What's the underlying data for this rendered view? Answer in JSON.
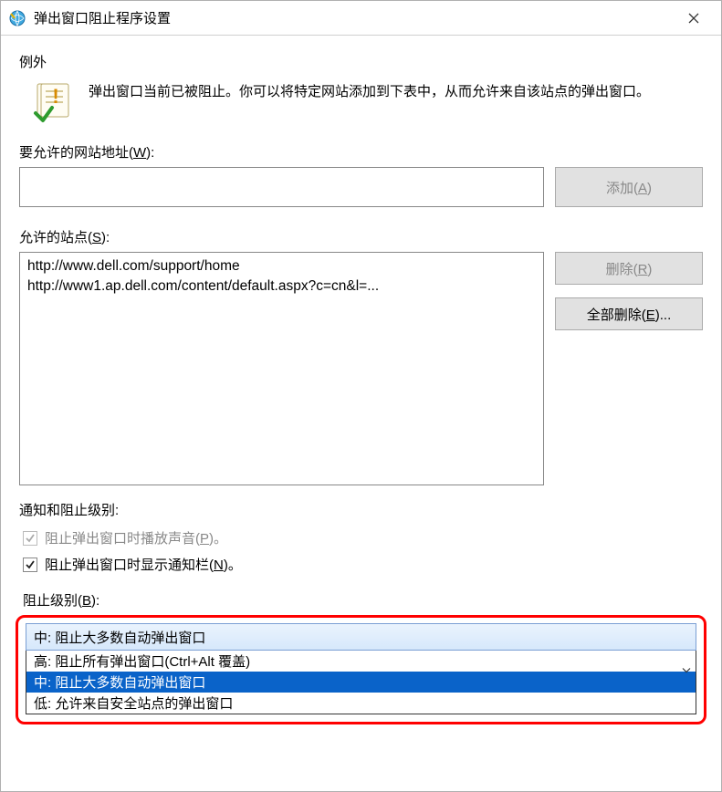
{
  "window": {
    "title": "弹出窗口阻止程序设置"
  },
  "exceptions": {
    "groupTitle": "例外",
    "infoText": "弹出窗口当前已被阻止。你可以将特定网站添加到下表中，从而允许来自该站点的弹出窗口。",
    "addressLabelPrefix": "要允许的网站地址(",
    "addressLabelKey": "W",
    "addressLabelSuffix": "):",
    "addressValue": "",
    "addButtonPrefix": "添加(",
    "addButtonKey": "A",
    "addButtonSuffix": ")",
    "allowedLabelPrefix": "允许的站点(",
    "allowedLabelKey": "S",
    "allowedLabelSuffix": "):",
    "sites": [
      "http://www.dell.com/support/home",
      "http://www1.ap.dell.com/content/default.aspx?c=cn&l=..."
    ],
    "removeButtonPrefix": "删除(",
    "removeButtonKey": "R",
    "removeButtonSuffix": ")",
    "removeAllButtonPrefix": "全部删除(",
    "removeAllButtonKey": "E",
    "removeAllButtonSuffix": ")..."
  },
  "notifications": {
    "groupTitle": "通知和阻止级别:",
    "playSoundChecked": true,
    "playSoundDisabled": true,
    "playSoundLabelPrefix": "阻止弹出窗口时播放声音(",
    "playSoundKey": "P",
    "playSoundLabelSuffix": ")。",
    "showBarChecked": true,
    "showBarLabelPrefix": "阻止弹出窗口时显示通知栏(",
    "showBarKey": "N",
    "showBarLabelSuffix": ")。",
    "levelLabelPrefix": "阻止级别(",
    "levelLabelKey": "B",
    "levelLabelSuffix": "):",
    "selectedLevel": "中: 阻止大多数自动弹出窗口",
    "levelOptions": [
      "高: 阻止所有弹出窗口(Ctrl+Alt 覆盖)",
      "中: 阻止大多数自动弹出窗口",
      "低: 允许来自安全站点的弹出窗口"
    ]
  }
}
